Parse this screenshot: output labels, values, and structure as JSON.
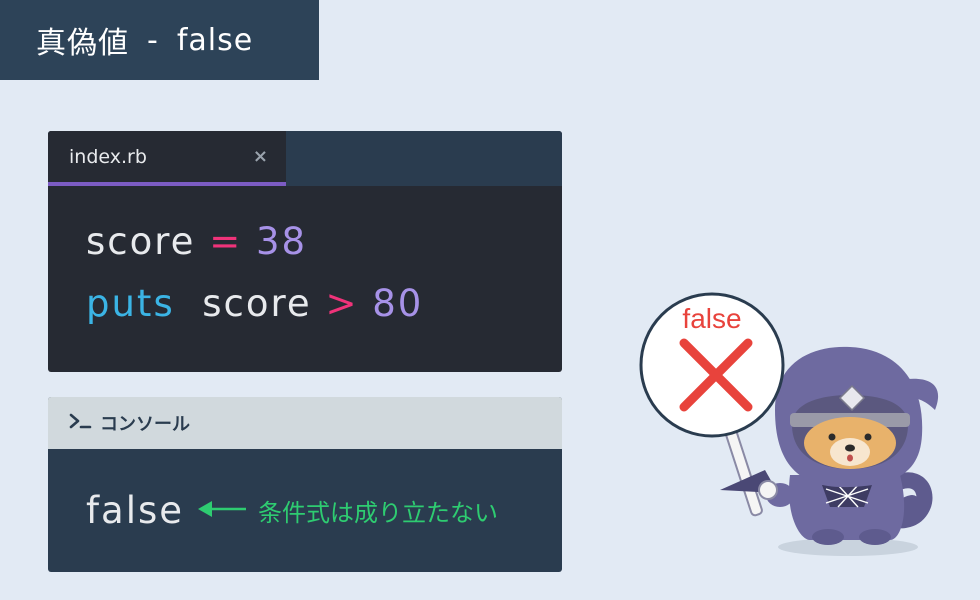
{
  "title": {
    "prefix": "真偽値",
    "separator": "-",
    "suffix": "false"
  },
  "editor": {
    "tab_label": "index.rb",
    "close_icon": "×",
    "lines": [
      {
        "a": "score",
        "op": "=",
        "num": "38"
      },
      {
        "method": "puts",
        "a": "score",
        "op": ">",
        "num": "80"
      }
    ]
  },
  "console": {
    "prompt_icon": "terminal-prompt-icon",
    "title": "コンソール",
    "output": "false",
    "annotation": "条件式は成り立たない"
  },
  "mascot": {
    "sign_text": "false"
  },
  "colors": {
    "banner": "#2d4358",
    "background": "#e2eaf4",
    "editor_bg": "#262a33",
    "tab_accent": "#7c5cc4",
    "operator": "#f0337a",
    "number": "#a792e8",
    "method": "#3bb4e5",
    "annotation": "#2ecc71",
    "cross": "#e8433c"
  }
}
